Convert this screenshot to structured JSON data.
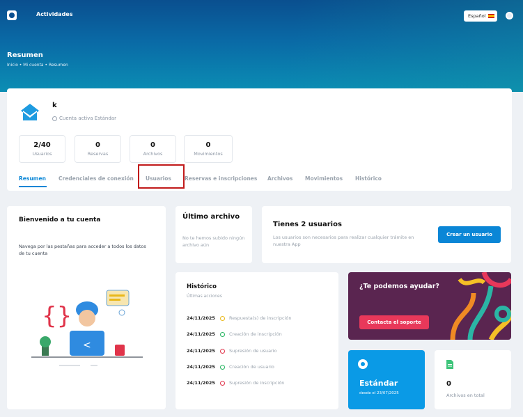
{
  "topbar": {
    "nav_link": "Actividades",
    "language": "Español"
  },
  "header": {
    "title": "Resumen",
    "breadcrumb": "Inicio  •  Mi cuenta  •  Resumen"
  },
  "profile": {
    "name": "k",
    "status": "Cuenta activa Estándar"
  },
  "stats": [
    {
      "value": "2/40",
      "label": "Usuarios"
    },
    {
      "value": "0",
      "label": "Reservas"
    },
    {
      "value": "0",
      "label": "Archivos"
    },
    {
      "value": "0",
      "label": "Movimientos"
    }
  ],
  "tabs": [
    {
      "label": "Resumen"
    },
    {
      "label": "Credenciales de conexión"
    },
    {
      "label": "Usuarios"
    },
    {
      "label": "Reservas e inscripciones"
    },
    {
      "label": "Archivos"
    },
    {
      "label": "Movimientos"
    },
    {
      "label": "Histórico"
    }
  ],
  "welcome": {
    "title": "Bienvenido a tu cuenta",
    "text": "Navega por las pestañas para acceder a todos los datos de tu cuenta"
  },
  "last_file": {
    "title": "Último archivo",
    "text": "No te hemos subido ningún archivo aún"
  },
  "users_card": {
    "title": "Tienes 2 usuarios",
    "text": "Los usuarios son necesarios para realizar cualquier trámite en nuestra App",
    "button": "Crear un usuario"
  },
  "history": {
    "title": "Histórico",
    "subtitle": "Últimas acciones",
    "items": [
      {
        "date": "24/11/2025",
        "desc": "Respuesta(s) de inscripción",
        "color": "#e9b81a"
      },
      {
        "date": "24/11/2025",
        "desc": "Creación de inscripción",
        "color": "#22b35e"
      },
      {
        "date": "24/11/2025",
        "desc": "Supresión de usuario",
        "color": "#e0344a"
      },
      {
        "date": "24/11/2025",
        "desc": "Creación de usuario",
        "color": "#22b35e"
      },
      {
        "date": "24/11/2025",
        "desc": "Supresión de inscripción",
        "color": "#e0344a"
      }
    ]
  },
  "help": {
    "title": "¿Te podemos ayudar?",
    "button": "Contacta el soporte"
  },
  "plan": {
    "name": "Estándar",
    "since": "desde el 23/07/2025"
  },
  "files_total": {
    "value": "0",
    "label": "Archivos en total"
  },
  "colors": {
    "accent": "#0a86d6",
    "hero": "#0a5f9c",
    "help_bg": "#5a2550",
    "help_button": "#e8385a",
    "plan_bg": "#0a9ae6"
  }
}
